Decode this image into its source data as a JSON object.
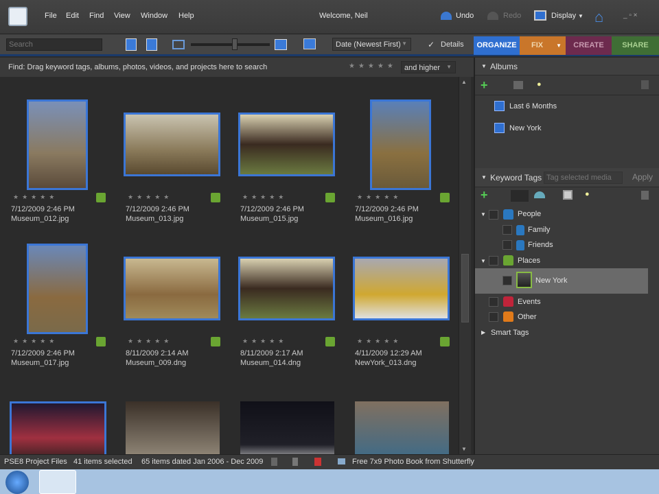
{
  "menu": {
    "items": [
      "File",
      "Edit",
      "Find",
      "View",
      "Window",
      "Help"
    ],
    "welcome": "Welcome, Neil",
    "undo": "Undo",
    "redo": "Redo",
    "display": "Display"
  },
  "toolbar": {
    "search_placeholder": "Search",
    "sort": "Date (Newest First)",
    "details": "Details"
  },
  "tabs": {
    "organize": "ORGANIZE",
    "fix": "FIX",
    "create": "CREATE",
    "share": "SHARE"
  },
  "findbar": {
    "text": "Find: Drag keyword tags, albums, photos, videos, and projects here to search",
    "rating_filter": "and higher"
  },
  "photos": [
    {
      "date": "7/12/2009 2:46 PM",
      "name": "Museum_012.jpg"
    },
    {
      "date": "7/12/2009 2:46 PM",
      "name": "Museum_013.jpg"
    },
    {
      "date": "7/12/2009 2:46 PM",
      "name": "Museum_015.jpg"
    },
    {
      "date": "7/12/2009 2:46 PM",
      "name": "Museum_016.jpg"
    },
    {
      "date": "7/12/2009 2:46 PM",
      "name": "Museum_017.jpg"
    },
    {
      "date": "8/11/2009 2:14 AM",
      "name": "Museum_009.dng"
    },
    {
      "date": "8/11/2009 2:17 AM",
      "name": "Museum_014.dng"
    },
    {
      "date": "4/11/2009 12:29 AM",
      "name": "NewYork_013.dng"
    }
  ],
  "albums": {
    "title": "Albums",
    "items": [
      "Last 6 Months",
      "New York"
    ]
  },
  "keywords": {
    "title": "Keyword Tags",
    "placeholder": "Tag selected media",
    "apply": "Apply",
    "items": [
      "People",
      "Family",
      "Friends",
      "Places",
      "New York",
      "Events",
      "Other",
      "Smart Tags"
    ]
  },
  "status": {
    "catalog": "PSE8 Project Files",
    "selected": "41 items selected",
    "dated": "65 items dated Jan 2006 - Dec 2009",
    "promo": "Free 7x9 Photo Book from Shutterfly"
  },
  "colors": {
    "organize": "#2f6fd0",
    "fix": "#c9762a",
    "create": "#6d2a4e",
    "share": "#3f6e35",
    "selection": "#3b76d6"
  }
}
